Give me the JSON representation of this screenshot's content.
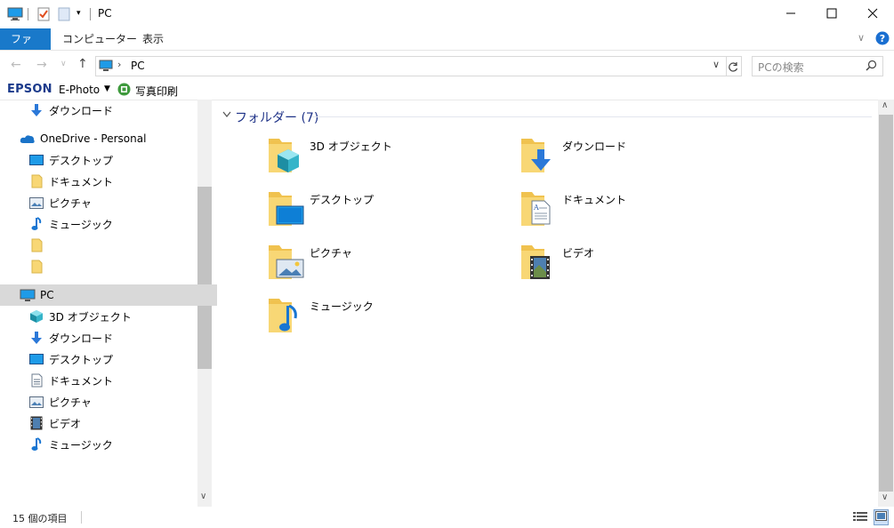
{
  "window": {
    "title": "PC"
  },
  "ribbon": {
    "tabs": [
      {
        "label": "ファイル"
      },
      {
        "label": "コンピューター"
      },
      {
        "label": "表示"
      }
    ]
  },
  "address": {
    "current": "PC",
    "search_placeholder": "PCの検索"
  },
  "epson": {
    "brand": "EPSON",
    "app": "E-Photo",
    "print": "写真印刷"
  },
  "nav": {
    "items": [
      {
        "label": "ダウンロード",
        "icon": "download-arrow-icon"
      },
      {
        "label": "OneDrive - Personal",
        "icon": "onedrive-cloud-icon"
      },
      {
        "label": "デスクトップ",
        "icon": "desktop-icon"
      },
      {
        "label": "ドキュメント",
        "icon": "folder-icon"
      },
      {
        "label": "ピクチャ",
        "icon": "pictures-icon"
      },
      {
        "label": "ミュージック",
        "icon": "music-note-icon"
      },
      {
        "label": "",
        "icon": "folder-icon"
      },
      {
        "label": "",
        "icon": "folder-icon"
      },
      {
        "label": "PC",
        "icon": "pc-icon"
      },
      {
        "label": "3D オブジェクト",
        "icon": "3d-objects-icon"
      },
      {
        "label": "ダウンロード",
        "icon": "download-arrow-icon"
      },
      {
        "label": "デスクトップ",
        "icon": "desktop-icon"
      },
      {
        "label": "ドキュメント",
        "icon": "document-icon"
      },
      {
        "label": "ピクチャ",
        "icon": "pictures-icon"
      },
      {
        "label": "ビデオ",
        "icon": "video-icon"
      },
      {
        "label": "ミュージック",
        "icon": "music-note-icon"
      }
    ]
  },
  "content": {
    "group_title": "フォルダー (7)",
    "folders": [
      {
        "label": "3D オブジェクト",
        "icon": "3d-objects-folder-icon"
      },
      {
        "label": "ダウンロード",
        "icon": "downloads-folder-icon"
      },
      {
        "label": "デスクトップ",
        "icon": "desktop-folder-icon"
      },
      {
        "label": "ドキュメント",
        "icon": "documents-folder-icon"
      },
      {
        "label": "ピクチャ",
        "icon": "pictures-folder-icon"
      },
      {
        "label": "ビデオ",
        "icon": "videos-folder-icon"
      },
      {
        "label": "ミュージック",
        "icon": "music-folder-icon"
      }
    ]
  },
  "status": {
    "count": "15 個の項目"
  },
  "colors": {
    "accent": "#1979ca",
    "folder": "#f5d67a",
    "group_header": "#1e3287",
    "selected": "#d9d9d9"
  }
}
